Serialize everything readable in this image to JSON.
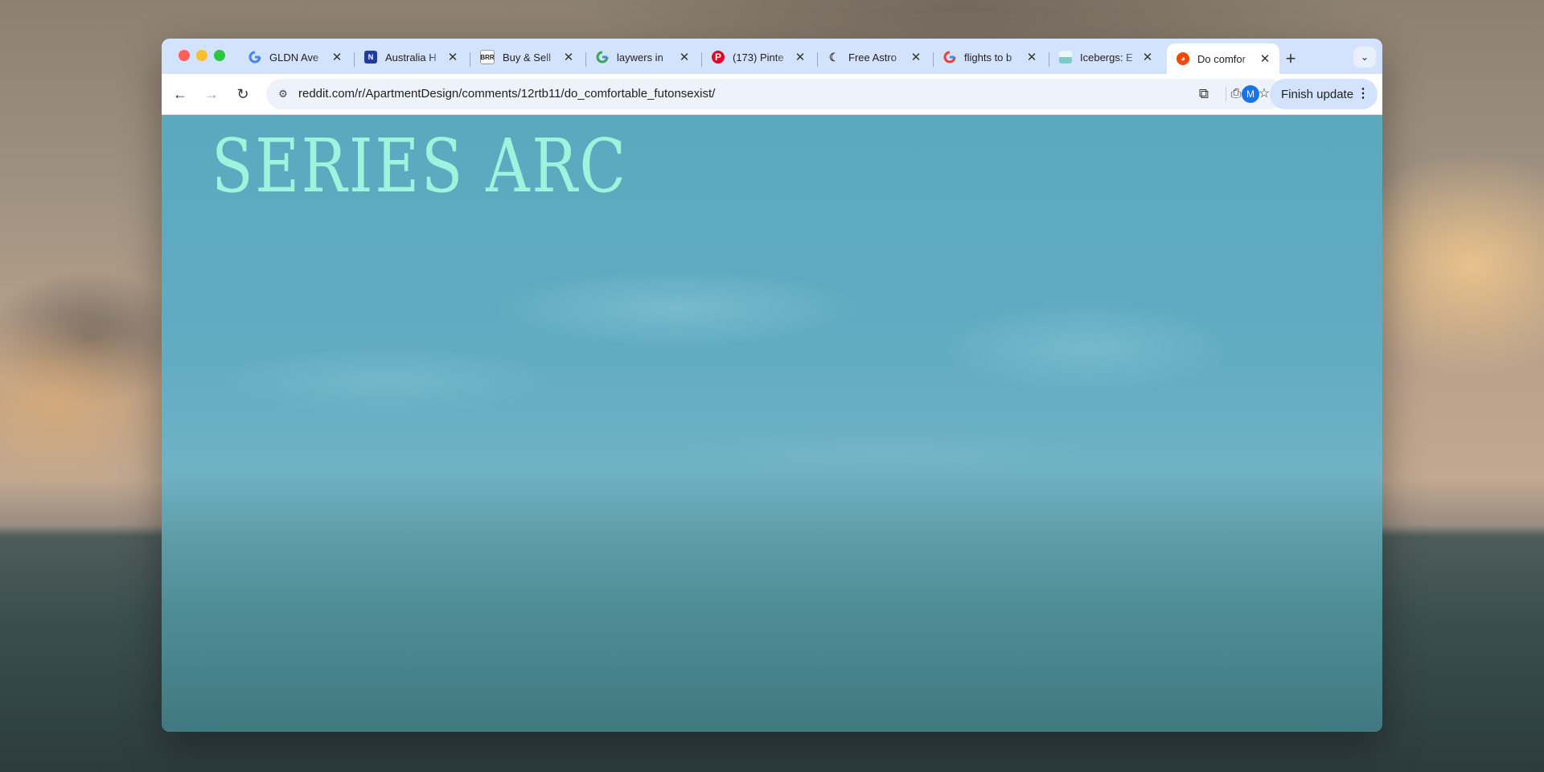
{
  "browser": {
    "tabs": [
      {
        "title": "GLDN Ave",
        "favicon": "google-g"
      },
      {
        "title": "Australia H",
        "favicon": "news-logo"
      },
      {
        "title": "Buy & Sell",
        "favicon": "brr-logo"
      },
      {
        "title": "laywers in",
        "favicon": "google-g"
      },
      {
        "title": "(173) Pinte",
        "favicon": "pinterest-logo"
      },
      {
        "title": "Free Astro",
        "favicon": "moon-icon"
      },
      {
        "title": "flights to b",
        "favicon": "google-g"
      },
      {
        "title": "Icebergs: E",
        "favicon": "iceberg-thumb"
      },
      {
        "title": "Do comfor",
        "favicon": "reddit-logo",
        "active": true
      }
    ],
    "newtab_label": "+",
    "url": "reddit.com/r/ApartmentDesign/comments/12rtb11/do_comfortable_futonsexist/",
    "avatar_letter": "M",
    "finish_update_label": "Finish update"
  },
  "page": {
    "title": "SERIES ARC"
  },
  "colors": {
    "tabbar_bg": "#d3e3fd",
    "hero_title": "#9ff2dc",
    "page_bg": "#5aa6bd"
  }
}
